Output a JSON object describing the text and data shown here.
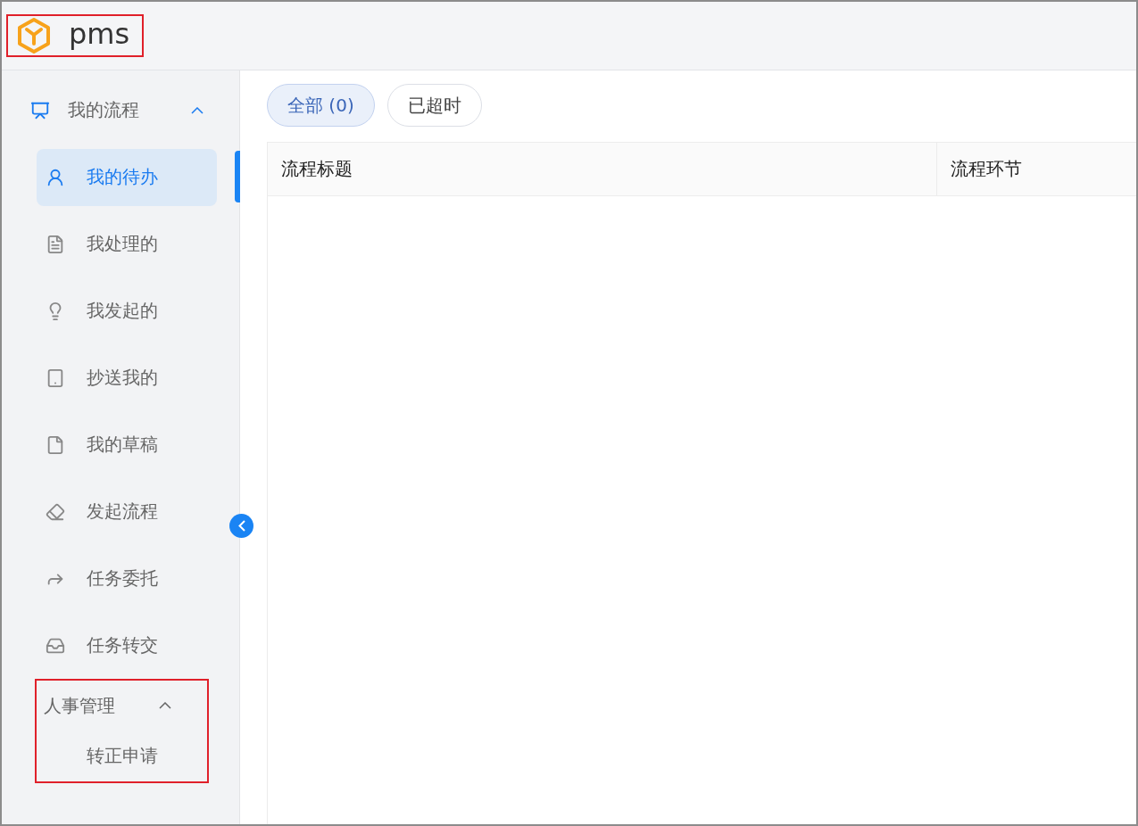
{
  "header": {
    "logo_text": "pms"
  },
  "sidebar": {
    "groups": [
      {
        "label": "我的流程",
        "expanded": true,
        "kind": "with-icons",
        "items": [
          {
            "label": "我的待办",
            "selected": true
          },
          {
            "label": "我处理的",
            "selected": false
          },
          {
            "label": "我发起的",
            "selected": false
          },
          {
            "label": "抄送我的",
            "selected": false
          },
          {
            "label": "我的草稿",
            "selected": false
          },
          {
            "label": "发起流程",
            "selected": false
          },
          {
            "label": "任务委托",
            "selected": false
          },
          {
            "label": "任务转交",
            "selected": false
          }
        ]
      },
      {
        "label": "人事管理",
        "expanded": true,
        "kind": "plain",
        "items": [
          {
            "label": "转正申请",
            "selected": false
          }
        ]
      }
    ]
  },
  "tabs": [
    {
      "label": "全部 (0)",
      "selected": true
    },
    {
      "label": "已超时",
      "selected": false
    }
  ],
  "table": {
    "columns": [
      "流程标题",
      "流程环节"
    ]
  }
}
